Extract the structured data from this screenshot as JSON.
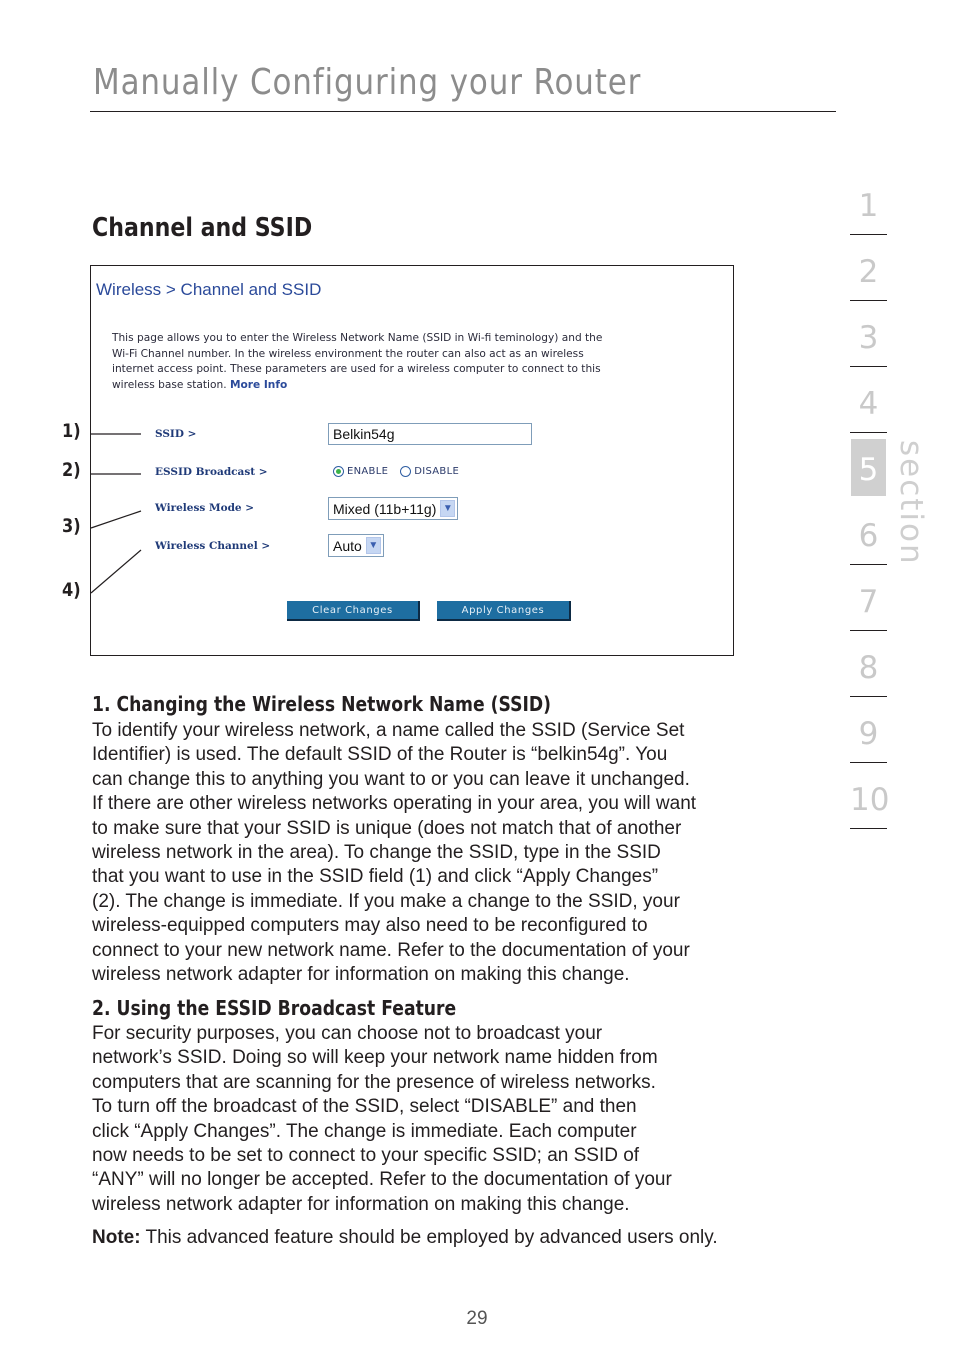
{
  "header": {
    "title": "Manually Configuring your Router"
  },
  "section_heading": "Channel and SSID",
  "screenshot": {
    "breadcrumb": "Wireless > Channel and SSID",
    "description_lines": [
      "This page allows you to enter the Wireless Network Name (SSID in Wi-fi teminology) and the",
      "Wi-Fi Channel number. In the wireless environment the router can also act as an wireless",
      "internet access point. These parameters are used for a wireless computer to connect to this",
      "wireless base station."
    ],
    "more_info_link": "More Info",
    "fields": {
      "ssid_label": "SSID >",
      "ssid_value": "Belkin54g",
      "essid_label": "ESSID Broadcast >",
      "enable_label": "ENABLE",
      "disable_label": "DISABLE",
      "essid_selected": "ENABLE",
      "mode_label": "Wireless Mode >",
      "mode_value": "Mixed (11b+11g)",
      "channel_label": "Wireless Channel >",
      "channel_value": "Auto"
    },
    "buttons": {
      "clear": "Clear Changes",
      "apply": "Apply Changes"
    }
  },
  "callouts": [
    "1)",
    "2)",
    "3)",
    "4)"
  ],
  "sections": [
    {
      "heading": "1. Changing the Wireless Network Name (SSID)",
      "lines": [
        "To identify your wireless network, a name called the SSID (Service Set",
        "Identifier) is used. The default SSID of the Router is “belkin54g”. You",
        "can change this to anything you want to or you can leave it unchanged.",
        "If there are other wireless networks operating in your area, you will want",
        "to make sure that your SSID is unique (does not match that of another",
        "wireless network in the area). To change the SSID, type in the SSID",
        "that you want to use in the SSID field (1) and click “Apply Changes”",
        "(2). The change is immediate. If you make a change to the SSID, your",
        "wireless-equipped computers may also need to be reconfigured to",
        "connect to your new network name. Refer to the documentation of your",
        "wireless network adapter for information on making this change."
      ]
    },
    {
      "heading": "2. Using the ESSID Broadcast Feature",
      "lines": [
        "For security purposes, you can choose not to broadcast your",
        "network’s SSID. Doing so will keep your network name hidden from",
        "computers that are scanning for the presence of wireless networks.",
        "To turn off the broadcast of the SSID, select “DISABLE” and then",
        "click “Apply Changes”. The change is immediate. Each computer",
        "now needs to be set to connect to your specific SSID; an SSID of",
        "“ANY” will no longer be accepted. Refer to the documentation of your",
        "wireless network adapter for information on making this change."
      ]
    }
  ],
  "note": {
    "label": "Note:",
    "text": " This advanced feature should be employed by advanced users only."
  },
  "page_number": "29",
  "section_nav": {
    "items": [
      "1",
      "2",
      "3",
      "4",
      "5",
      "6",
      "7",
      "8",
      "9",
      "10"
    ],
    "active": "5",
    "label": "section"
  }
}
